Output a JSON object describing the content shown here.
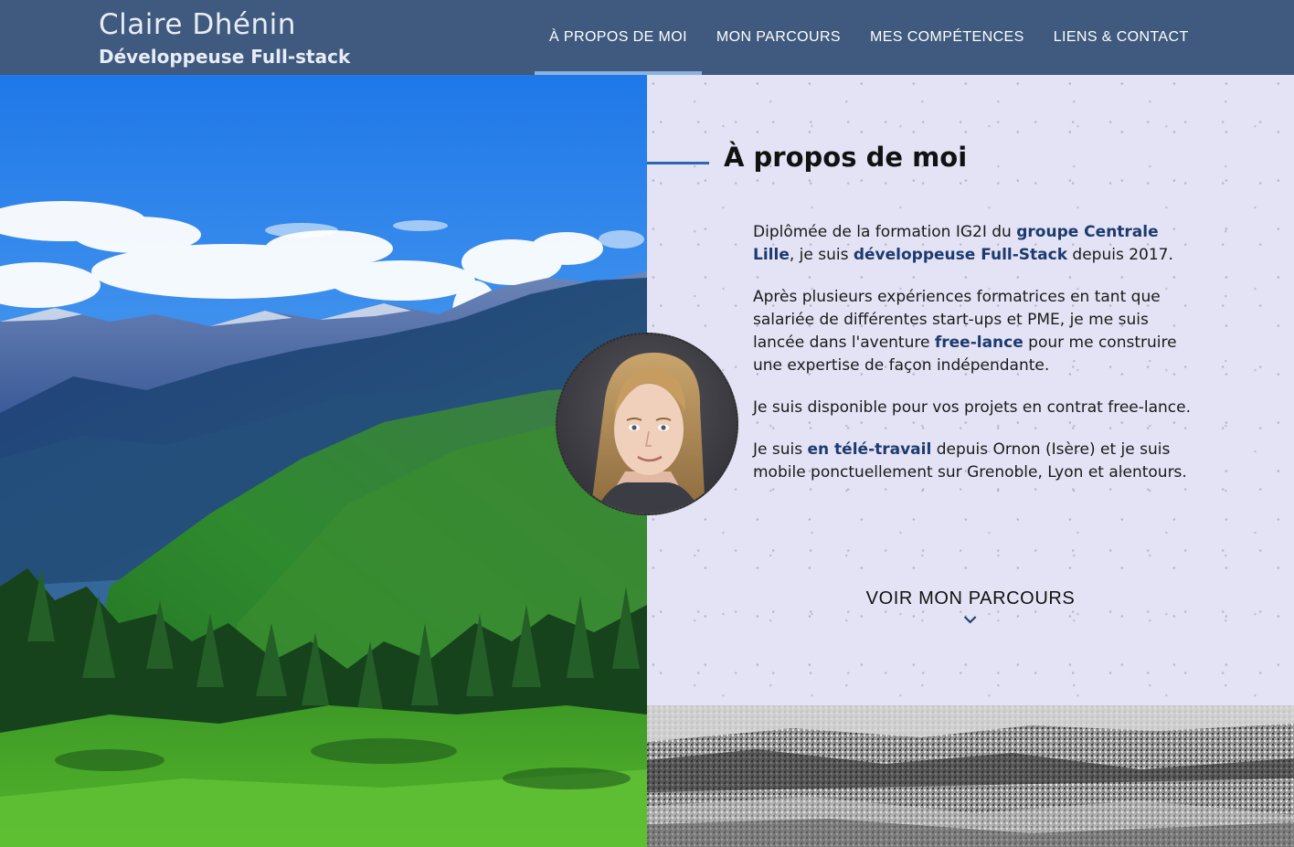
{
  "brand": {
    "name": "Claire Dhénin",
    "subtitle": "Développeuse Full-stack"
  },
  "nav": {
    "items": [
      {
        "label": "À PROPOS DE MOI",
        "active": true
      },
      {
        "label": "MON PARCOURS",
        "active": false
      },
      {
        "label": "MES COMPÉTENCES",
        "active": false
      },
      {
        "label": "LIENS & CONTACT",
        "active": false
      }
    ]
  },
  "about": {
    "title": "À propos de moi",
    "p1": {
      "t1": "Diplômée de la formation IG2I du ",
      "b1": "groupe Centrale Lille",
      "t2": ", je suis ",
      "b2": "développeuse Full-Stack",
      "t3": " depuis 2017."
    },
    "p2": {
      "t1": "Après plusieurs expériences formatrices en tant que salariée de différentes start-ups et PME, je me suis lancée dans l'aventure ",
      "b1": "free-lance",
      "t2": " pour me construire une expertise de façon indépendante."
    },
    "p3": "Je suis disponible pour vos projets en contrat free-lance.",
    "p4": {
      "t1": "Je suis ",
      "b1": "en télé-travail",
      "t2": " depuis Ornon (Isère) et je suis mobile ponctuellement sur Grenoble, Lyon et alentours."
    },
    "cta_label": "VOIR MON PARCOURS"
  },
  "icons": {
    "cta": "chevron-down-icon"
  },
  "colors": {
    "header_bg": "#3f5a7e",
    "nav_active_underline": "#8cb3e0",
    "accent_line": "#2f66b3",
    "emphasis_text": "#1d3a6e",
    "content_bg": "#e3e3f5"
  }
}
